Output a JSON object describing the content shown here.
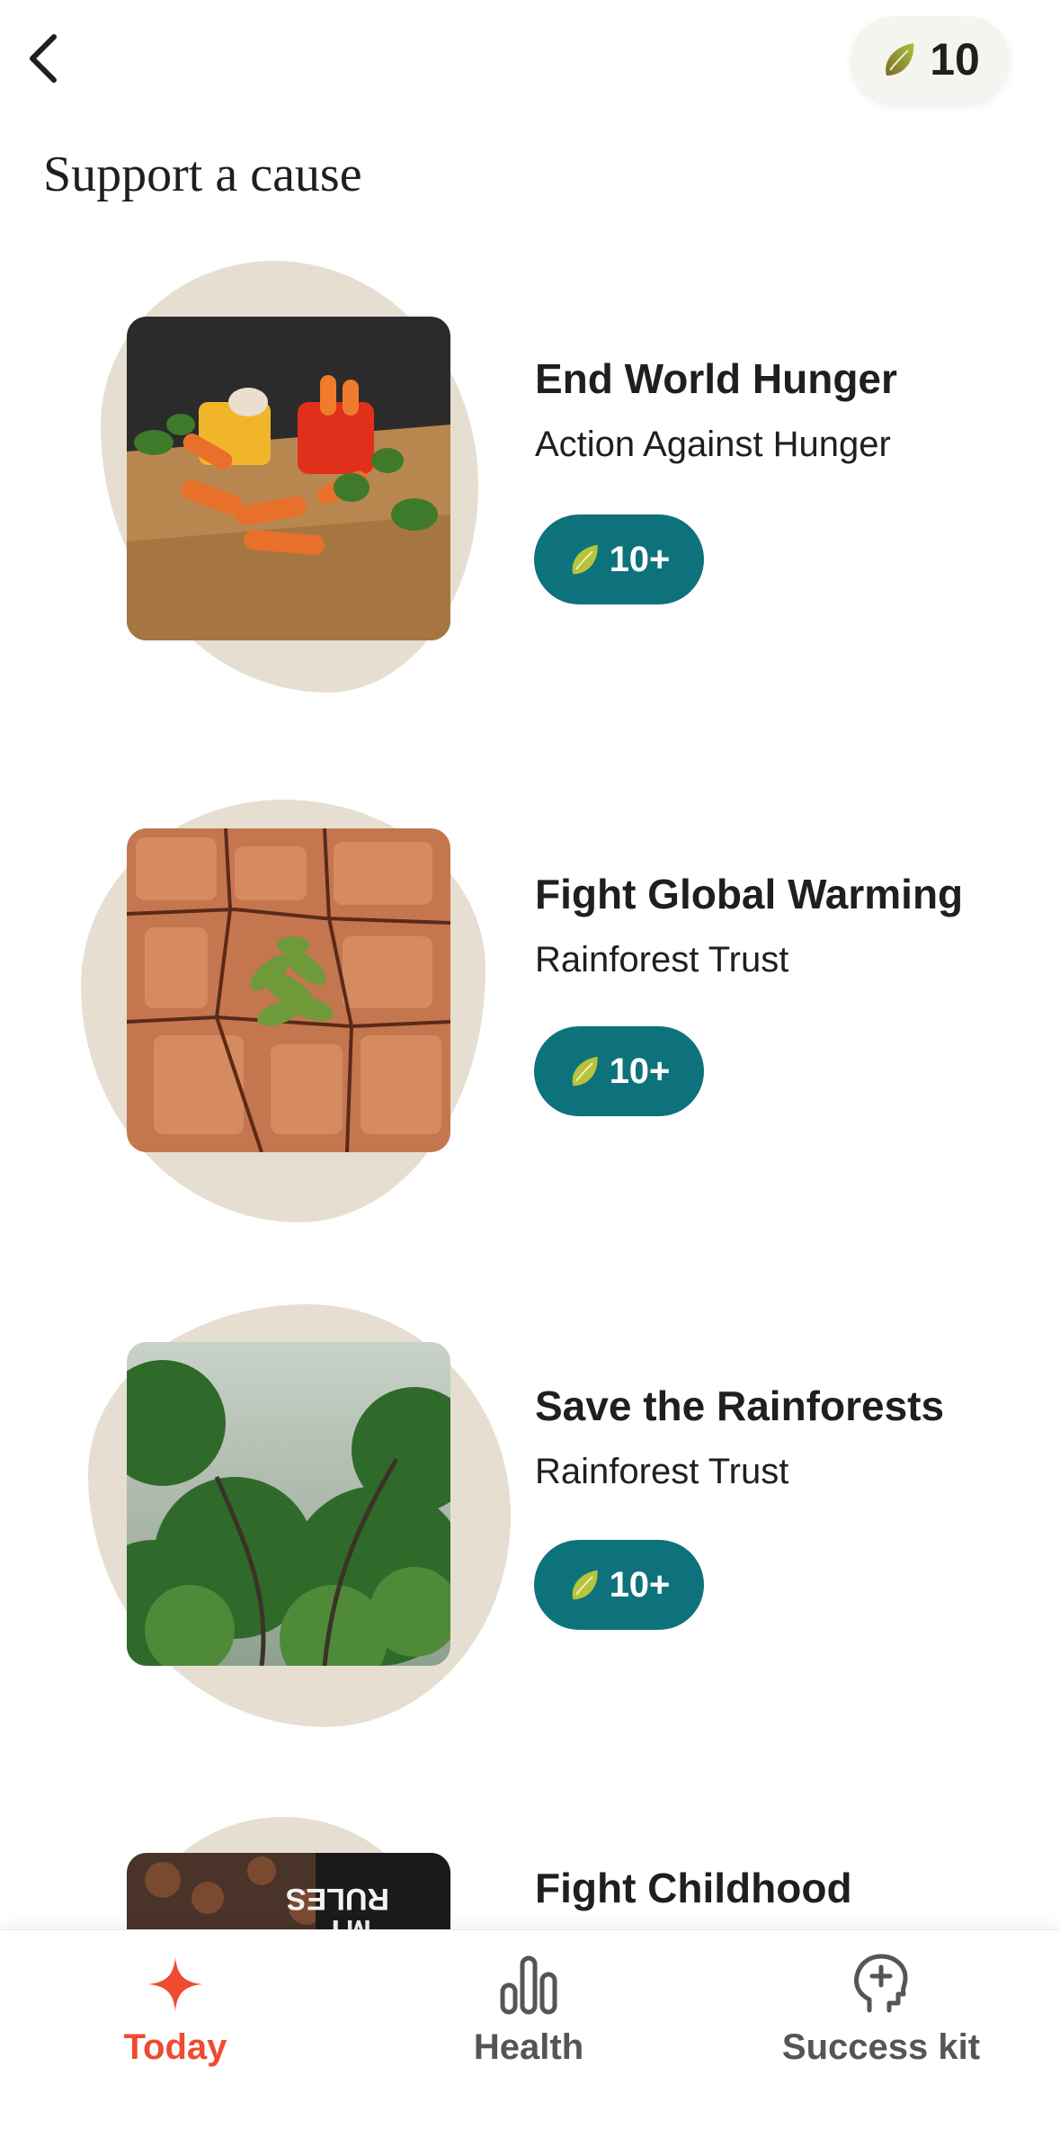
{
  "header": {
    "back_icon": "chevron-left-icon",
    "seed_icon": "seed-icon",
    "seed_count": "10"
  },
  "page": {
    "title": "Support a cause"
  },
  "causes": [
    {
      "title": "End World Hunger",
      "organization": "Action Against Hunger",
      "reward": "10+",
      "image": "vegetables-on-cutting-board"
    },
    {
      "title": "Fight Global Warming",
      "organization": "Rainforest Trust",
      "reward": "10+",
      "image": "cracked-earth-with-plant"
    },
    {
      "title": "Save the Rainforests",
      "organization": "Rainforest Trust",
      "reward": "10+",
      "image": "misty-rainforest"
    },
    {
      "title": "Fight Childhood",
      "organization": "",
      "reward": "",
      "image": "child-on-leaves"
    }
  ],
  "tabbar": {
    "tabs": [
      {
        "label": "Today",
        "icon": "sparkle-icon",
        "active": true
      },
      {
        "label": "Health",
        "icon": "bar-chart-icon",
        "active": false
      },
      {
        "label": "Success kit",
        "icon": "head-plus-icon",
        "active": false
      }
    ]
  },
  "colors": {
    "accent": "#f04a30",
    "reward_badge": "#0e727c",
    "blob": "#e6dfd1",
    "inactive_tab": "#555555"
  }
}
